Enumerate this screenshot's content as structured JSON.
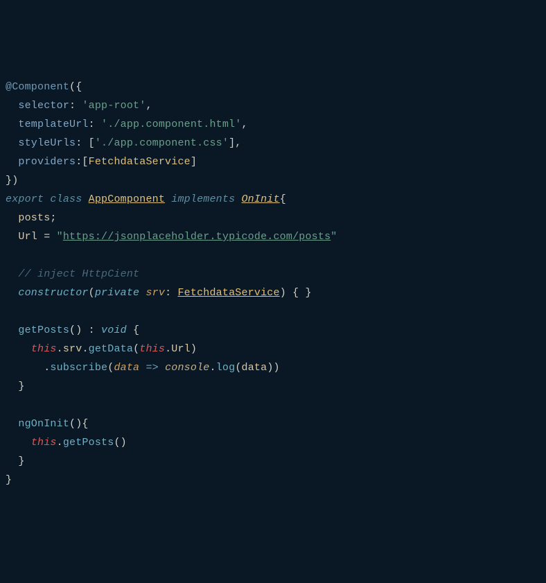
{
  "code": {
    "decorator": "@Component",
    "paren_open": "({",
    "key_selector": "selector",
    "val_selector": "'app-root'",
    "key_templateUrl": "templateUrl",
    "val_templateUrl": "'./app.component.html'",
    "key_styleUrls": "styleUrls",
    "val_styleUrls": "'./app.component.css'",
    "key_providers": "providers",
    "val_providers": "FetchdataService",
    "close_paren": "})",
    "kw_export": "export",
    "kw_class": "class",
    "class_name": "AppComponent",
    "kw_implements": "implements",
    "iface_name": "OnInit",
    "prop_posts": "posts",
    "prop_url": "Url",
    "url_str_open": "\"",
    "url_value": "https://jsonplaceholder.typicode.com/posts",
    "url_str_close": "\"",
    "comment_inject": "// inject HttpCient",
    "ctor": "constructor",
    "kw_private": "private",
    "param_srv": "srv",
    "type_fds": "FetchdataService",
    "fn_getPosts": "getPosts",
    "kw_void": "void",
    "kw_this": "this",
    "prop_srv": "srv",
    "fn_getData": "getData",
    "prop_Url2": "Url",
    "fn_subscribe": "subscribe",
    "param_data": "data",
    "arrow": "=>",
    "obj_console": "console",
    "fn_log": "log",
    "fn_ngOnInit": "ngOnInit"
  }
}
